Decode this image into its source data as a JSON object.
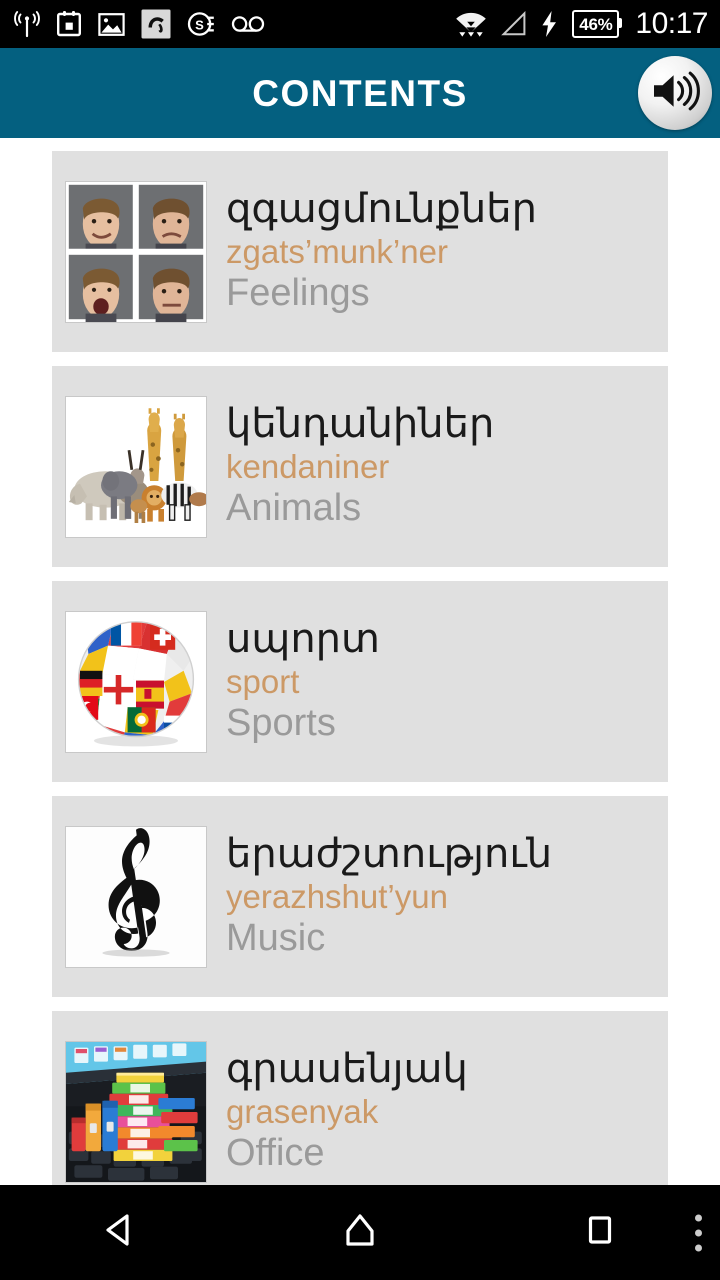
{
  "status_bar": {
    "left_icons": [
      {
        "name": "broadcast-tower-icon",
        "label": "cell-broadcast"
      },
      {
        "name": "calendar-icon",
        "label": "calendar"
      },
      {
        "name": "gallery-image-icon",
        "label": "gallery"
      },
      {
        "name": "avira-umbrella-icon",
        "label": "avira"
      },
      {
        "name": "se-badge-icon",
        "label": "SE"
      },
      {
        "name": "voicemail-icon",
        "label": "voicemail"
      }
    ],
    "right_icons": [
      {
        "name": "wifi-icon",
        "label": "wifi"
      },
      {
        "name": "cell-signal-icon",
        "label": "signal"
      },
      {
        "name": "charging-bolt-icon",
        "label": "charging"
      }
    ],
    "battery_percent": "46%",
    "clock": "10:17"
  },
  "header": {
    "title": "CONTENTS",
    "speaker_icon": "speaker-volume-icon",
    "bg_color": "#046080",
    "title_color": "#ffffff"
  },
  "colors": {
    "card_bg": "#e0e0e0",
    "native_text": "#1a1a1a",
    "transliteration_text": "#cc9966",
    "english_text": "#9a9a9a",
    "page_bg": "#ffffff",
    "nav_bg": "#000000"
  },
  "list": {
    "items": [
      {
        "native": "զգացմունքներ",
        "translit": "zgats’munk’ner",
        "english": "Feelings",
        "thumb": "faces-grid-thumbnail"
      },
      {
        "native": "կենդանիներ",
        "translit": "kendaniner",
        "english": "Animals",
        "thumb": "animals-group-thumbnail"
      },
      {
        "native": "սպորտ",
        "translit": "sport",
        "english": "Sports",
        "thumb": "flag-soccer-ball-thumbnail"
      },
      {
        "native": "երաժշտություն",
        "translit": "yerazhshut’yun",
        "english": "Music",
        "thumb": "treble-clef-thumbnail"
      },
      {
        "native": "գրասենյակ",
        "translit": "grasenyak",
        "english": "Office",
        "thumb": "binders-laptop-thumbnail"
      }
    ]
  },
  "nav_bar": {
    "buttons": [
      {
        "name": "back-button",
        "label": "Back"
      },
      {
        "name": "home-button",
        "label": "Home"
      },
      {
        "name": "recents-button",
        "label": "Recents"
      },
      {
        "name": "overflow-menu-button",
        "label": "More options"
      }
    ]
  }
}
